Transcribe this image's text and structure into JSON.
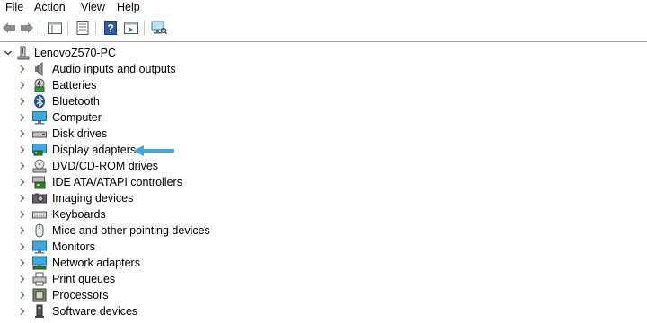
{
  "menu": [
    {
      "label": "File"
    },
    {
      "label": "Action"
    },
    {
      "label": "View"
    },
    {
      "label": "Help"
    }
  ],
  "toolbar": {
    "buttons": [
      "back-icon",
      "forward-icon",
      "console-tree-icon",
      "properties-icon",
      "help-icon",
      "action-pane-icon",
      "scan-hardware-icon"
    ]
  },
  "tree": {
    "root": {
      "label": "LenovoZ570-PC",
      "icon": "computer-tree-icon"
    },
    "items": [
      {
        "label": "Audio inputs and outputs",
        "icon": "speaker-icon"
      },
      {
        "label": "Batteries",
        "icon": "battery-icon"
      },
      {
        "label": "Bluetooth",
        "icon": "bluetooth-icon"
      },
      {
        "label": "Computer",
        "icon": "monitor-icon"
      },
      {
        "label": "Disk drives",
        "icon": "disk-drive-icon"
      },
      {
        "label": "Display adapters",
        "icon": "display-adapter-icon"
      },
      {
        "label": "DVD/CD-ROM drives",
        "icon": "dvd-icon"
      },
      {
        "label": "IDE ATA/ATAPI controllers",
        "icon": "ide-controller-icon"
      },
      {
        "label": "Imaging devices",
        "icon": "camera-icon"
      },
      {
        "label": "Keyboards",
        "icon": "keyboard-icon"
      },
      {
        "label": "Mice and other pointing devices",
        "icon": "mouse-icon"
      },
      {
        "label": "Monitors",
        "icon": "monitor-icon"
      },
      {
        "label": "Network adapters",
        "icon": "network-icon"
      },
      {
        "label": "Print queues",
        "icon": "printer-icon"
      },
      {
        "label": "Processors",
        "icon": "processor-icon"
      },
      {
        "label": "Software devices",
        "icon": "software-device-icon"
      }
    ]
  },
  "annotation": {
    "points_to": "Display adapters",
    "color": "#3fa9dc"
  }
}
